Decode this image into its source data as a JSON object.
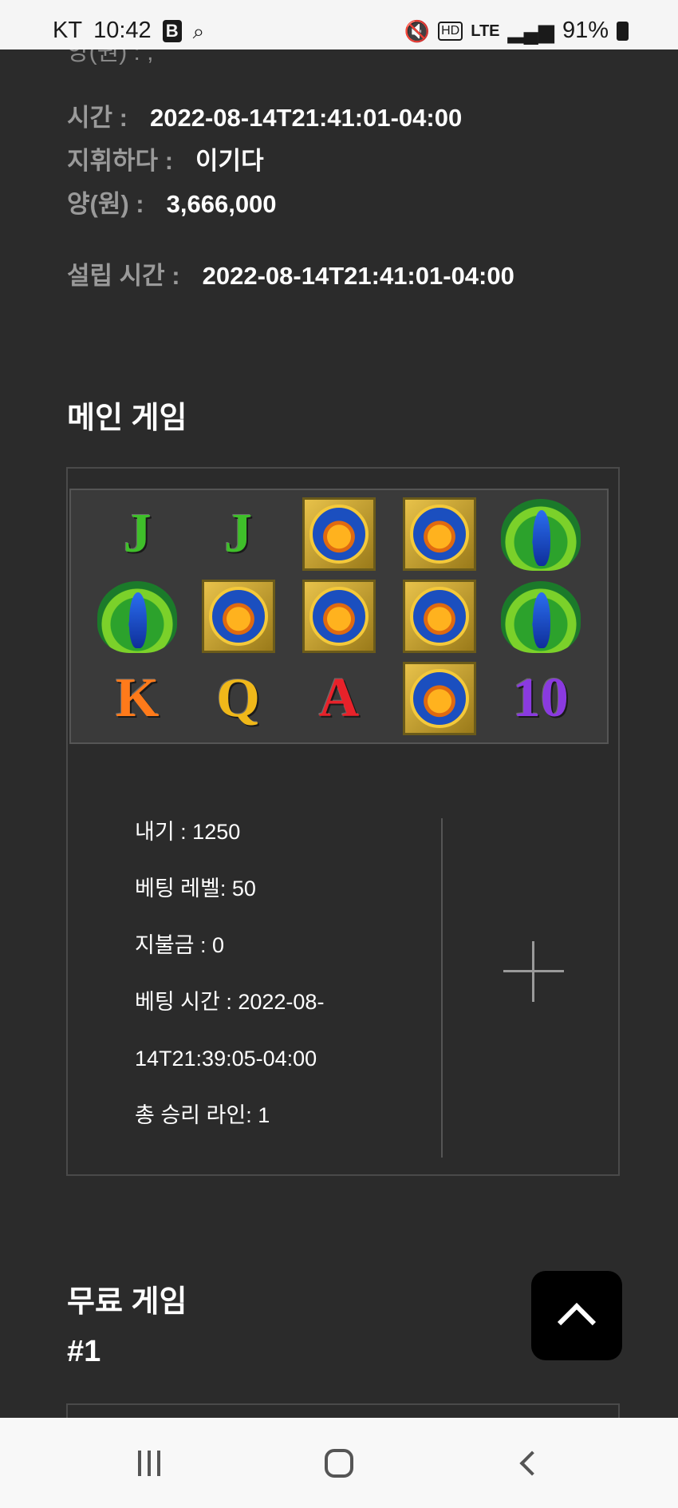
{
  "status_bar": {
    "carrier": "KT",
    "time": "10:42",
    "network": "LTE",
    "battery": "91%"
  },
  "detail_info": {
    "cut_text": "양(원) : ,",
    "time_label": "시간 :",
    "time_value": "2022-08-14T21:41:01-04:00",
    "command_label": "지휘하다 :",
    "command_value": "이기다",
    "amount_label": "양(원) :",
    "amount_value": "3,666,000",
    "settle_label": "설립 시간 :",
    "settle_value": "2022-08-14T21:41:01-04:00"
  },
  "main_game": {
    "title": "메인 게임",
    "reels": [
      [
        "J",
        "J",
        "lotus",
        "lotus",
        "peacock"
      ],
      [
        "peacock",
        "lotus",
        "lotus",
        "lotus",
        "peacock"
      ],
      [
        "K",
        "Q",
        "A",
        "lotus",
        "10"
      ]
    ],
    "symbol_colors": {
      "J": "#3fbf2a",
      "K": "#ff7a1a",
      "Q": "#f0b81a",
      "A": "#e8222a",
      "10": "#8a3ae0"
    },
    "stats": {
      "bet": "내기 : 1250",
      "bet_level": "베팅 레벨: 50",
      "payout": "지불금 : 0",
      "bet_time_1": "베팅 시간 : 2022-08-",
      "bet_time_2": "14T21:39:05-04:00",
      "win_lines": "총 승리 라인: 1"
    },
    "expand_icon": "plus-icon"
  },
  "free_game": {
    "title": "무료 게임",
    "number": "#1"
  },
  "scroll_top_icon": "chevron-up-icon",
  "nav_bar": {
    "recent": "recent-apps-icon",
    "home": "home-icon",
    "back": "back-icon"
  }
}
